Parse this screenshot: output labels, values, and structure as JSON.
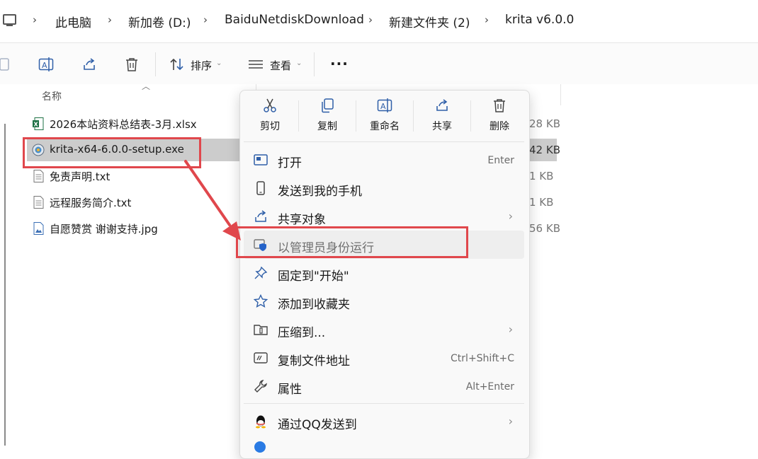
{
  "breadcrumb": {
    "items": [
      "此电脑",
      "新加卷 (D:)",
      "BaiduNetdiskDownload",
      "新建文件夹 (2)",
      "krita v6.0.0"
    ]
  },
  "toolbar": {
    "sort_label": "排序",
    "view_label": "查看",
    "more_label": "···"
  },
  "file_list": {
    "column_name": "名称",
    "files": [
      {
        "name": "2026本站资料总结表-3月.xlsx",
        "size": "28 KB",
        "icon": "excel-file-icon"
      },
      {
        "name": "krita-x64-6.0.0-setup.exe",
        "size": "42 KB",
        "icon": "exe-file-icon",
        "selected": true
      },
      {
        "name": "免责声明.txt",
        "size": "1 KB",
        "icon": "text-file-icon"
      },
      {
        "name": "远程服务简介.txt",
        "size": "1 KB",
        "icon": "text-file-icon"
      },
      {
        "name": "自愿赞赏 谢谢支持.jpg",
        "size": "56 KB",
        "icon": "image-file-icon"
      }
    ]
  },
  "context_menu": {
    "quick_actions": [
      "剪切",
      "复制",
      "重命名",
      "共享",
      "删除"
    ],
    "items": [
      {
        "label": "打开",
        "shortcut": "Enter"
      },
      {
        "label": "发送到我的手机",
        "shortcut": ""
      },
      {
        "label": "共享对象",
        "shortcut": "",
        "submenu": true
      },
      {
        "label": "以管理员身份运行",
        "shortcut": "",
        "highlighted": true
      },
      {
        "label": "固定到\"开始\"",
        "shortcut": ""
      },
      {
        "label": "添加到收藏夹",
        "shortcut": ""
      },
      {
        "label": "压缩到...",
        "shortcut": "",
        "submenu": true
      },
      {
        "label": "复制文件地址",
        "shortcut": "Ctrl+Shift+C"
      },
      {
        "label": "属性",
        "shortcut": "Alt+Enter"
      },
      {
        "label": "通过QQ发送到",
        "shortcut": "",
        "submenu": true
      }
    ],
    "submenu_arrow": "›"
  },
  "colors": {
    "annotation_red": "#e0474c",
    "accent_blue": "#2563c9"
  }
}
